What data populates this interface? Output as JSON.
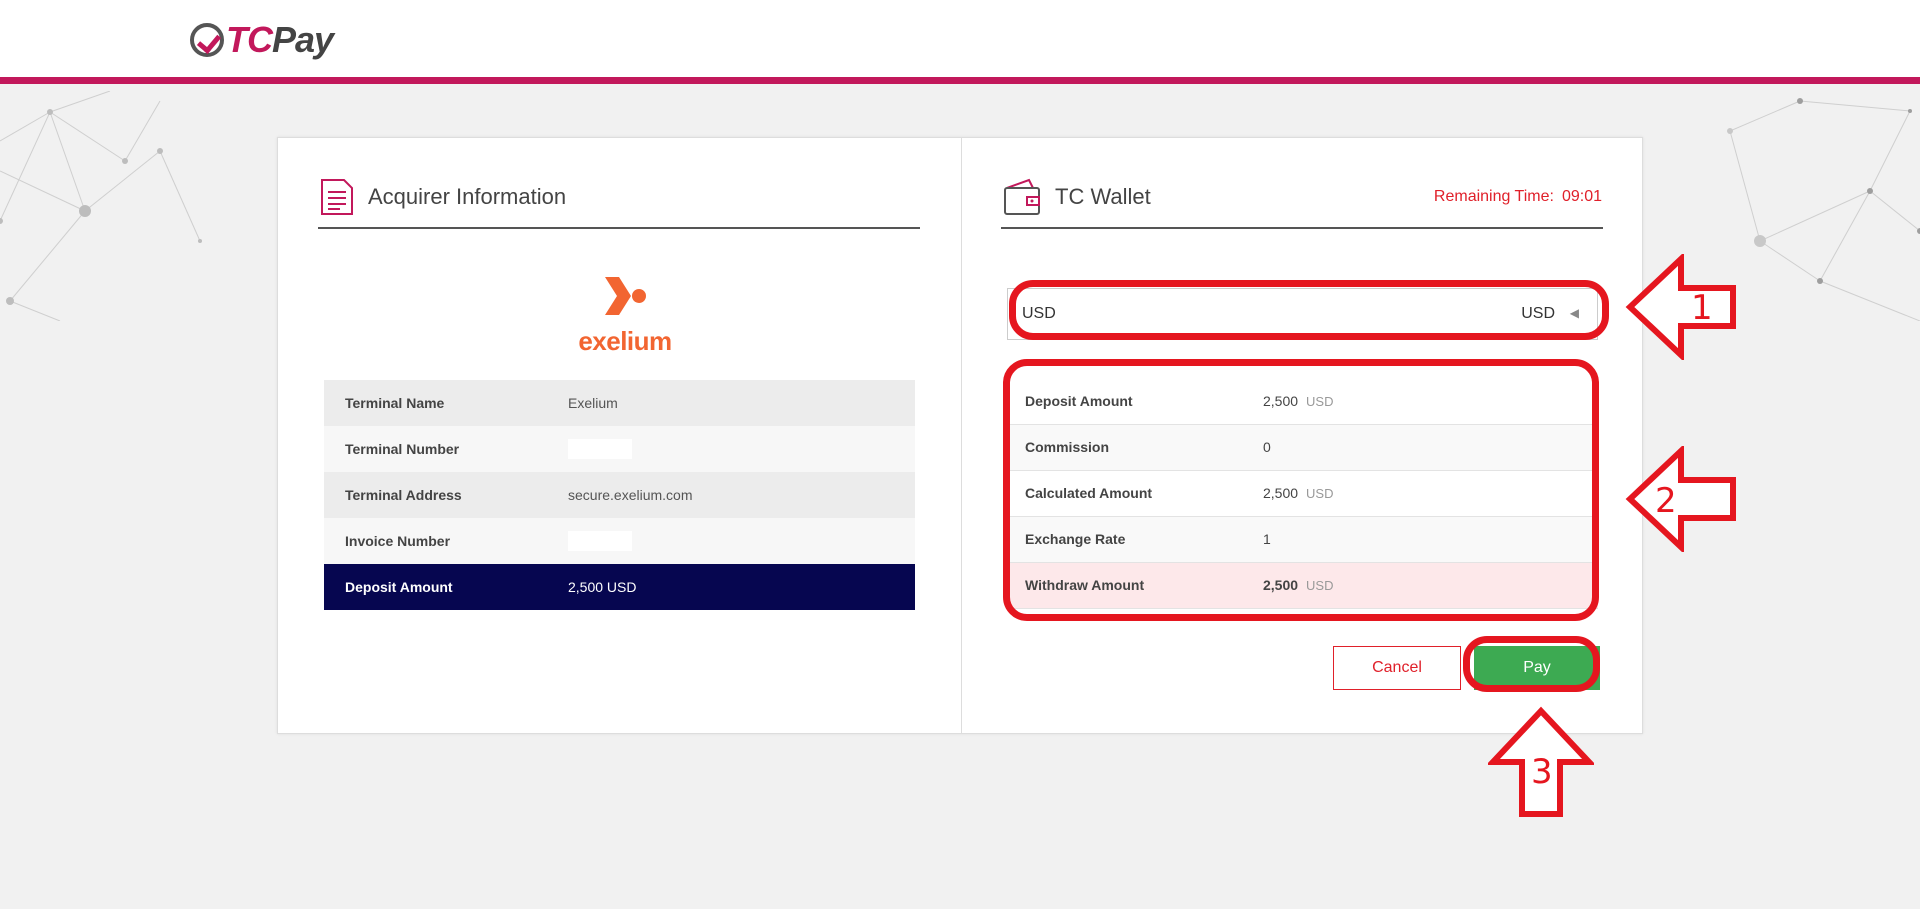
{
  "header": {
    "logo_tc": "TC",
    "logo_pay": "Pay"
  },
  "acquirer": {
    "title": "Acquirer Information",
    "logo_text": "exelium",
    "rows": [
      {
        "label": "Terminal Name",
        "value": "Exelium"
      },
      {
        "label": "Terminal Number",
        "value": ""
      },
      {
        "label": "Terminal Address",
        "value": "secure.exelium.com"
      },
      {
        "label": "Invoice Number",
        "value": ""
      },
      {
        "label": "Deposit Amount",
        "value": "2,500 USD"
      }
    ]
  },
  "wallet": {
    "title": "TC Wallet",
    "remaining_label": "Remaining Time:",
    "remaining_value": "09:01",
    "currency_left": "USD",
    "currency_right": "USD",
    "rows": [
      {
        "label": "Deposit Amount",
        "value": "2,500",
        "unit": "USD"
      },
      {
        "label": "Commission",
        "value": "0",
        "unit": ""
      },
      {
        "label": "Calculated Amount",
        "value": "2,500",
        "unit": "USD"
      },
      {
        "label": "Exchange Rate",
        "value": "1",
        "unit": ""
      },
      {
        "label": "Withdraw Amount",
        "value": "2,500",
        "unit": "USD"
      }
    ],
    "cancel_label": "Cancel",
    "pay_label": "Pay"
  },
  "annotations": {
    "step1": "1",
    "step2": "2",
    "step3": "3"
  },
  "colors": {
    "brand": "#c2185b",
    "navy": "#060650",
    "pay_green": "#3daa52",
    "alert_red": "#e0202a",
    "annotation_red": "#e5161f",
    "exelium_orange": "#f26531"
  }
}
